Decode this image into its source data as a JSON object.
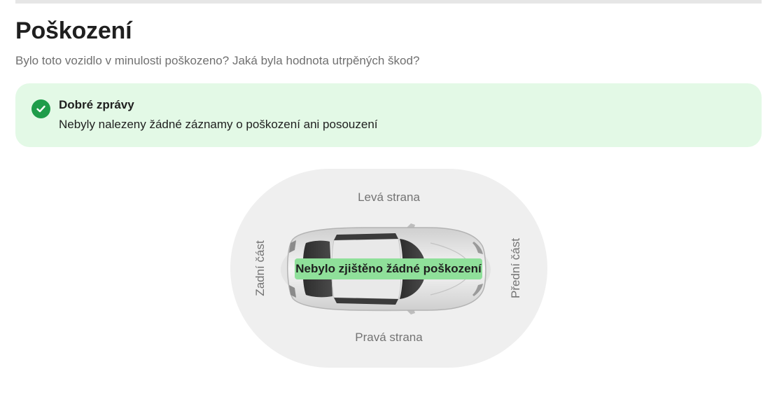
{
  "section": {
    "title": "Poškození",
    "subtitle": "Bylo toto vozidlo v minulosti poškozeno? Jaká byla hodnota utrpěných škod?"
  },
  "alert": {
    "icon": "check-circle-icon",
    "title": "Dobré zprávy",
    "text": "Nebyly nalezeny žádné záznamy o poškození ani posouzení",
    "background_color": "#e3f9e6",
    "icon_color": "#1f9c4a"
  },
  "diagram": {
    "left_side_label": "Levá strana",
    "right_side_label": "Pravá strana",
    "rear_label": "Zadní část",
    "front_label": "Přední část",
    "status": "Nebylo zjištěno žádné poškození",
    "status_color": "#8fe09a",
    "car_icon": "car-top-view-icon"
  }
}
